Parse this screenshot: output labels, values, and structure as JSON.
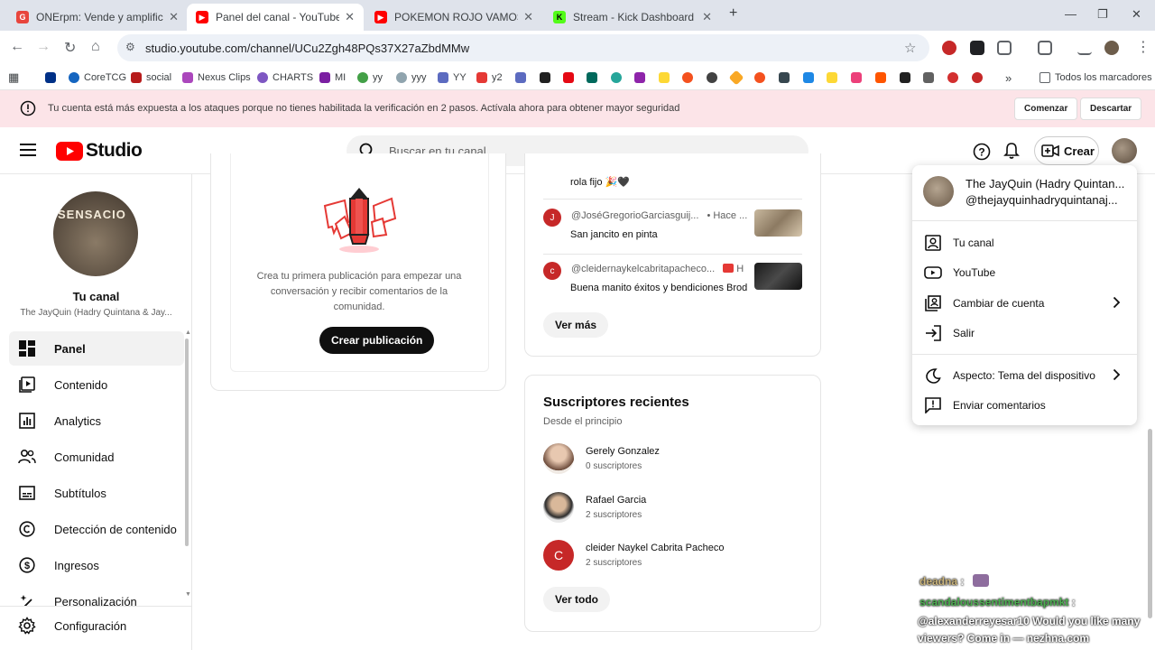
{
  "browser": {
    "tabs": [
      {
        "title": "ONErpm: Vende y amplifica tu m",
        "color": "#e8453c"
      },
      {
        "title": "Panel del canal - YouTube Studi",
        "color": "#ff0000"
      },
      {
        "title": "POKEMON ROJO VAMOS POR",
        "color": "#ff0000"
      },
      {
        "title": "Stream - Kick Dashboard",
        "color": "#53fc18"
      }
    ],
    "url": "studio.youtube.com/channel/UCu2Zgh48PQs37X27aZbdMMw",
    "bookmarks": [
      "CoreTCG",
      "social",
      "Nexus Clips",
      "CHARTS",
      "MI",
      "yy",
      "yyy",
      "YY",
      "y2"
    ],
    "all_bookmarks": "Todos los marcadores",
    "more_bookmarks": "»"
  },
  "banner": {
    "message": "Tu cuenta está más expuesta a los ataques porque no tienes habilitada la verificación en 2 pasos. Actívala ahora para obtener mayor seguridad",
    "start_label": "Comenzar",
    "dismiss_label": "Descartar"
  },
  "header": {
    "logo_text": "Studio",
    "search_placeholder": "Buscar en tu canal",
    "create_label": "Crear"
  },
  "sidebar": {
    "channel_heading": "Tu canal",
    "channel_name": "The JayQuin (Hadry Quintana & Jay...",
    "avatar_text": "SENSACIO",
    "items": [
      {
        "label": "Panel",
        "icon": "dashboard-icon"
      },
      {
        "label": "Contenido",
        "icon": "content-icon"
      },
      {
        "label": "Analytics",
        "icon": "analytics-icon"
      },
      {
        "label": "Comunidad",
        "icon": "community-icon"
      },
      {
        "label": "Subtítulos",
        "icon": "subtitles-icon"
      },
      {
        "label": "Detección de contenido",
        "icon": "copyright-icon"
      },
      {
        "label": "Ingresos",
        "icon": "earn-icon"
      },
      {
        "label": "Personalización",
        "icon": "customization-icon"
      }
    ],
    "settings_label": "Configuración"
  },
  "post_card": {
    "text": "Crea tu primera publicación para empezar una conversación y recibir comentarios de la comunidad.",
    "button_label": "Crear publicación"
  },
  "comments": {
    "prev_text": "rola fijo 🎉🖤",
    "items": [
      {
        "user": "@JoséGregorioGarciasguij...",
        "time": "• Hace ...",
        "text": "San jancito en pinta",
        "initial": "J",
        "color": "#c62828"
      },
      {
        "user": "@cleidernaykelcabritapacheco...",
        "time": "H",
        "text": "Buena manito éxitos y bendiciones Brod",
        "initial": "c",
        "color": "#c62828"
      }
    ],
    "see_more_label": "Ver más"
  },
  "recent_subscribers": {
    "title": "Suscriptores recientes",
    "subtitle": "Desde el principio",
    "items": [
      {
        "name": "Gerely Gonzalez",
        "count": "0 suscriptores"
      },
      {
        "name": "Rafael Garcia",
        "count": "2 suscriptores"
      },
      {
        "name": "cleider Naykel Cabrita Pacheco",
        "count": "2 suscriptores",
        "initial": "C"
      }
    ],
    "see_all_label": "Ver todo"
  },
  "account_menu": {
    "name": "The JayQuin (Hadry Quintan...",
    "handle": "@thejayquinhadryquintanaj...",
    "items": [
      {
        "label": "Tu canal",
        "icon": "account-box-icon"
      },
      {
        "label": "YouTube",
        "icon": "youtube-icon"
      },
      {
        "label": "Cambiar de cuenta",
        "icon": "switch-account-icon",
        "chevron": true
      },
      {
        "label": "Salir",
        "icon": "sign-out-icon"
      },
      {
        "label": "Aspecto: Tema del dispositivo",
        "icon": "moon-icon",
        "chevron": true
      },
      {
        "label": "Enviar comentarios",
        "icon": "feedback-icon"
      }
    ]
  },
  "chat_overlay": [
    {
      "user": "deadna",
      "text": ":"
    },
    {
      "user": "scandaloussentimentbapmkt",
      "text": ":"
    },
    {
      "user": "",
      "text": "@alexanderreyesar10 Would you like many"
    },
    {
      "user": "",
      "text": "viewers? Come in — nezhna.com"
    }
  ],
  "colors": {
    "brand_red": "#ff0000",
    "banner_bg": "#fce4e8",
    "chat_green": "#4caf50",
    "chat_tan": "#c9b37a"
  }
}
